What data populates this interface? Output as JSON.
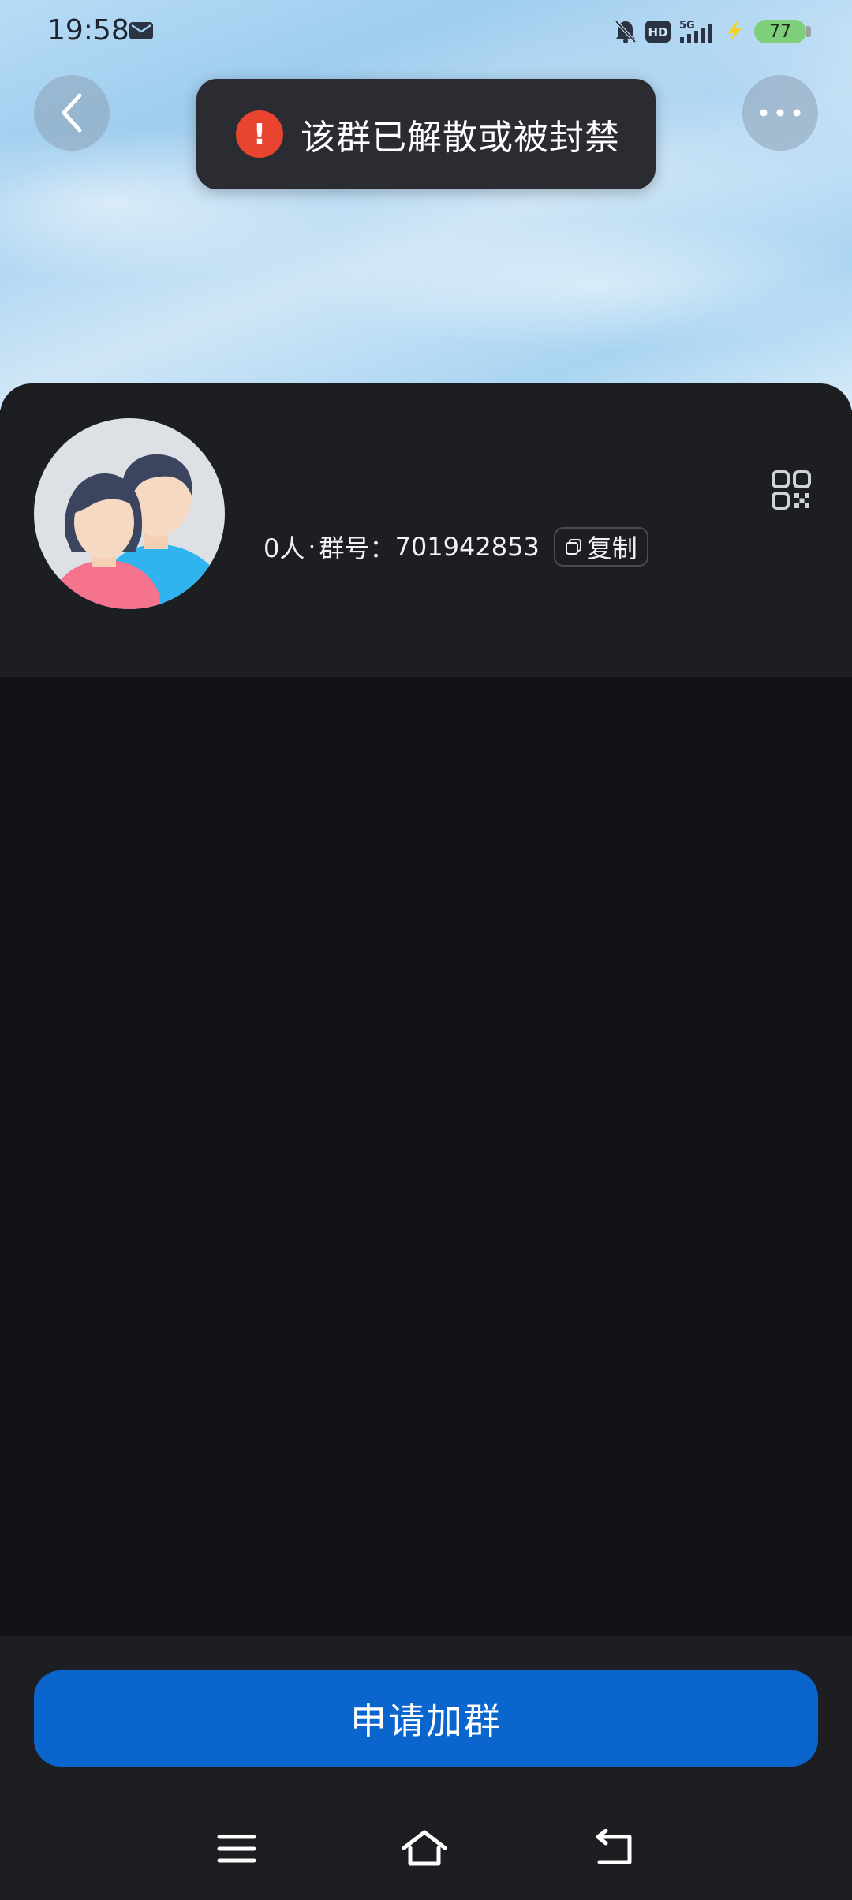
{
  "status_bar": {
    "time": "19:58",
    "battery": "77",
    "icons": [
      "mail-icon",
      "mute-bell-icon",
      "hd-icon",
      "5g-signal-icon",
      "charging-icon",
      "battery-icon"
    ]
  },
  "toast": {
    "icon": "exclamation-icon",
    "message": "该群已解散或被封禁"
  },
  "group": {
    "members": "0人",
    "separator": "·",
    "id_label": "群号：",
    "id": "701942853",
    "copy_label": "复制"
  },
  "actions": {
    "apply_label": "申请加群"
  },
  "colors": {
    "accent": "#0a66cc",
    "toast_icon": "#e8442f",
    "card_bg": "#1d1e21",
    "page_bg": "#121316"
  }
}
